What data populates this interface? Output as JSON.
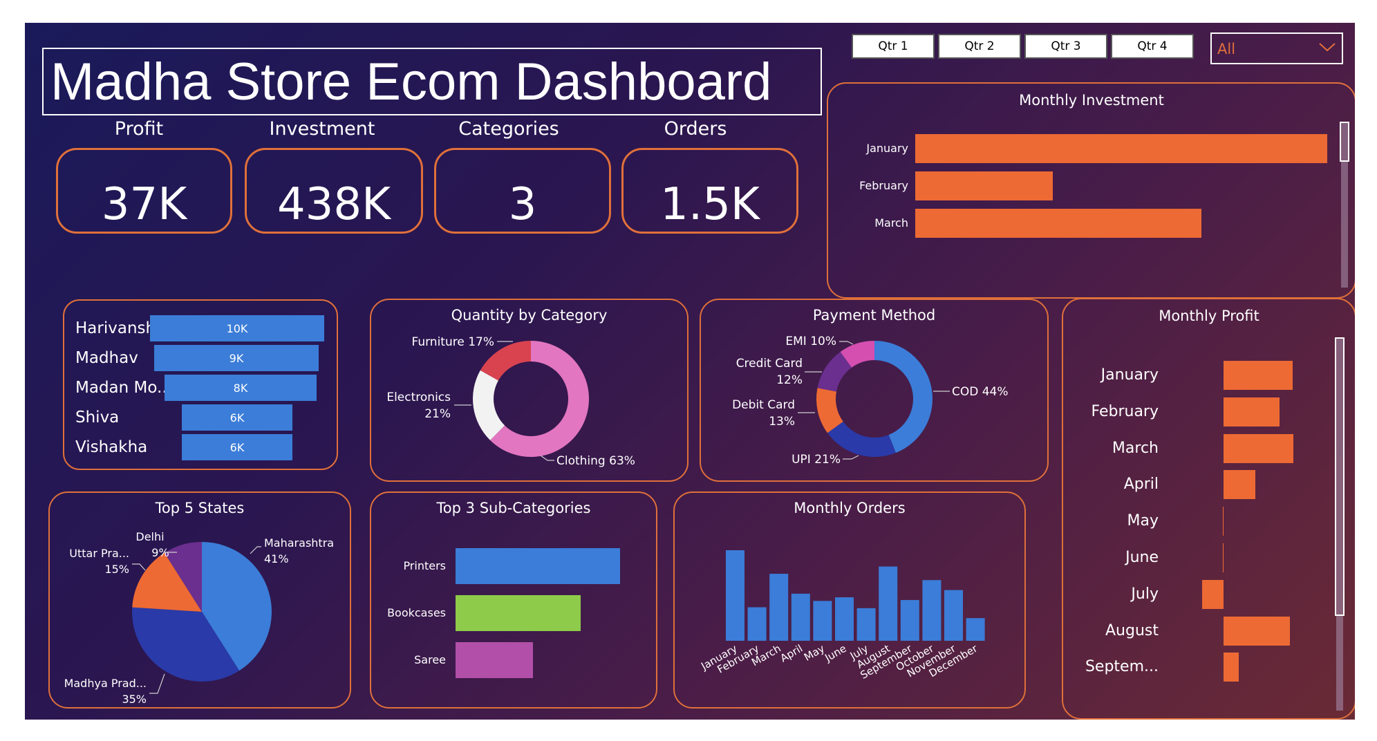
{
  "title": "Madha Store Ecom Dashboard",
  "kpis": [
    {
      "label": "Profit",
      "value": "37K"
    },
    {
      "label": "Investment",
      "value": "438K"
    },
    {
      "label": "Categories",
      "value": "3"
    },
    {
      "label": "Orders",
      "value": "1.5K"
    }
  ],
  "quarters": [
    "Qtr 1",
    "Qtr 2",
    "Qtr 3",
    "Qtr 4"
  ],
  "dropdown": {
    "value": "All"
  },
  "colors": {
    "accent": "#e0703a",
    "blue": "#3b7dd8",
    "orange": "#ed6a34"
  },
  "chart_data": [
    {
      "id": "monthly_investment",
      "type": "bar",
      "orientation": "horizontal",
      "title": "Monthly Investment",
      "categories": [
        "January",
        "February",
        "March"
      ],
      "values": [
        180,
        60,
        125
      ],
      "color": "#ed6a34"
    },
    {
      "id": "customers",
      "type": "bar",
      "orientation": "horizontal",
      "categories": [
        "Harivansh",
        "Madhav",
        "Madan Mo...",
        "Shiva",
        "Vishakha"
      ],
      "values": [
        10,
        9,
        8,
        6,
        6
      ],
      "data_labels": [
        "10K",
        "9K",
        "8K",
        "6K",
        "6K"
      ],
      "color": "#3b7dd8"
    },
    {
      "id": "quantity_by_category",
      "type": "pie",
      "donut": true,
      "title": "Quantity by Category",
      "slices": [
        {
          "label": "Clothing",
          "value": 63,
          "text": "Clothing 63%",
          "color": "#e276c0"
        },
        {
          "label": "Electronics",
          "value": 21,
          "text": "Electronics 21%",
          "color": "#f2f2f2"
        },
        {
          "label": "Furniture",
          "value": 17,
          "text": "Furniture 17%",
          "color": "#d9434f"
        }
      ]
    },
    {
      "id": "payment_method",
      "type": "pie",
      "donut": true,
      "title": "Payment Method",
      "slices": [
        {
          "label": "COD",
          "value": 44,
          "text": "COD 44%",
          "color": "#3b7dd8"
        },
        {
          "label": "UPI",
          "value": 21,
          "text": "UPI 21%",
          "color": "#2a3aa8"
        },
        {
          "label": "Debit Card",
          "value": 13,
          "text": "Debit Card 13%",
          "color": "#ed6a34"
        },
        {
          "label": "Credit Card",
          "value": 12,
          "text": "Credit Card 12%",
          "color": "#6b2f8f"
        },
        {
          "label": "EMI",
          "value": 10,
          "text": "EMI 10%",
          "color": "#d44fb0"
        }
      ]
    },
    {
      "id": "monthly_profit",
      "type": "bar",
      "orientation": "horizontal",
      "title": "Monthly Profit",
      "categories": [
        "January",
        "February",
        "March",
        "April",
        "May",
        "June",
        "July",
        "August",
        "Septem..."
      ],
      "values": [
        7.8,
        6.3,
        7.9,
        3.6,
        -0.1,
        -0.1,
        -2.4,
        7.5,
        1.7
      ],
      "color": "#ed6a34"
    },
    {
      "id": "top_states",
      "type": "pie",
      "title": "Top 5 States",
      "slices": [
        {
          "label": "Maharashtra",
          "value": 41,
          "text": "Maharashtra 41%",
          "color": "#3b7dd8"
        },
        {
          "label": "Madhya Prad...",
          "value": 35,
          "text": "Madhya Prad... 35%",
          "color": "#2a3aa8"
        },
        {
          "label": "Uttar Pra...",
          "value": 15,
          "text": "Uttar Pra... 15%",
          "color": "#ed6a34"
        },
        {
          "label": "Delhi",
          "value": 9,
          "text": "Delhi 9%",
          "color": "#6b2f8f"
        }
      ]
    },
    {
      "id": "top_subcategories",
      "type": "bar",
      "orientation": "horizontal",
      "title": "Top 3 Sub-Categories",
      "categories": [
        "Printers",
        "Bookcases",
        "Saree"
      ],
      "values": [
        100,
        76,
        47
      ],
      "colors": [
        "#3b7dd8",
        "#8ecb4a",
        "#b24fa8"
      ]
    },
    {
      "id": "monthly_orders",
      "type": "bar",
      "title": "Monthly Orders",
      "categories": [
        "January",
        "February",
        "March",
        "April",
        "May",
        "June",
        "July",
        "August",
        "September",
        "October",
        "November",
        "December"
      ],
      "values": [
        100,
        37,
        74,
        52,
        44,
        48,
        36,
        82,
        45,
        67,
        56,
        25
      ],
      "color": "#3b7dd8"
    }
  ]
}
